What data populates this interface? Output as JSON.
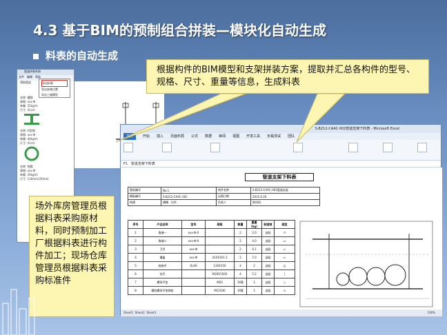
{
  "slide": {
    "title": "4.3 基于BIM的预制组合拼装—模块化自动生成",
    "bullet": "料表的自动生成"
  },
  "callout_top": "根据构件的BIM模型和支架拼装方案，提取并汇总各构件的型号、规格、尺寸、重量等信息，生成料表",
  "callout_left": "场外库房管理员根据料表采购原材料，同时预制加工厂根据料表进行构件加工；现场仓库管理员根据料表采购标准件",
  "app": {
    "title": "管道拼装系统",
    "menu": [
      "文件",
      "编辑",
      "帮助"
    ],
    "left_label": "预制管架",
    "dropdown": [
      "导出料表",
      "导出安装位置",
      "导出三维模型"
    ],
    "items": [
      {
        "name": "名称:",
        "value": "槽钢"
      },
      {
        "name": "规格:",
        "value": "xxx-Φ"
      },
      {
        "name": "单重:",
        "value": "25kg/m"
      },
      {
        "name": "尺寸:",
        "value": "41cm"
      },
      {
        "name": "名称:",
        "value": "H型钢"
      },
      {
        "name": "规格:",
        "value": "xxx-Φ"
      },
      {
        "name": "单重:",
        "value": "40kg/m"
      },
      {
        "name": "尺寸:",
        "value": "41cm"
      },
      {
        "name": "名称:",
        "value": "抱箍"
      },
      {
        "name": "规格:",
        "value": "xxx-Φ"
      },
      {
        "name": "单重:",
        "value": "30kg/m"
      },
      {
        "name": "尺寸:",
        "value": "130mm150mm"
      }
    ]
  },
  "excel": {
    "window_title": "S-B212-CAAC-002管道支架下料表 - Microsoft Excel",
    "tabs": [
      "文件",
      "开始",
      "插入",
      "页面布局",
      "公式",
      "数据",
      "审阅",
      "视图",
      "开发工具",
      "负载测试",
      "团队"
    ],
    "cell_ref": "F1",
    "formula": "管道支架下料表",
    "sheet_title": "管道支架下料表",
    "info": [
      [
        "图纸编号",
        "No.1",
        "构件名称",
        "S-B212-CAAC-002管道支架"
      ],
      [
        "模板编号",
        "S-B212-CAAC-002",
        "出图日期",
        "2015.6.26"
      ],
      [
        "构建",
        "横撑、拉杆、",
        "负责人",
        "陈科科"
      ]
    ],
    "parts_headers": [
      "序号",
      "产品名称",
      "型号",
      "规格",
      "数量",
      "重量(kg)",
      "制造商",
      "图型"
    ],
    "parts": [
      [
        "1",
        "角端一",
        "xxx-Φ-0",
        "",
        "2",
        "2.0",
        "自配"
      ],
      [
        "2",
        "角端二",
        "xxx-Φ-0",
        "",
        "2",
        "4.0",
        "自配"
      ],
      [
        "3",
        "卫吊",
        "xxx-Φ",
        "",
        "2",
        "0.1",
        "自配"
      ],
      [
        "4",
        "槽盒",
        "xxx-Φ",
        "41X41X1.3",
        "2",
        "7.0",
        "自配"
      ],
      [
        "5",
        "底座件",
        "XLA6",
        "130X150",
        "4",
        "2",
        "自配"
      ],
      [
        "6",
        "拉杆",
        "",
        "M20X1500",
        "4",
        "5.2",
        "自配"
      ],
      [
        "7",
        "螺母平垫",
        "",
        "M20",
        "16套",
        "1",
        "自配"
      ],
      [
        "8",
        "螺栓螺母平垫弹垫",
        "",
        "M12X40",
        "16套",
        "1",
        "自配"
      ]
    ],
    "sheets": [
      "Sheet1",
      "Sheet2",
      "Sheet3"
    ],
    "zoom": "100%"
  },
  "colors": {
    "callout_bg": "#fdf6b2",
    "slide_top": "#4a6d9e",
    "slide_bottom": "#a8c3e6"
  }
}
